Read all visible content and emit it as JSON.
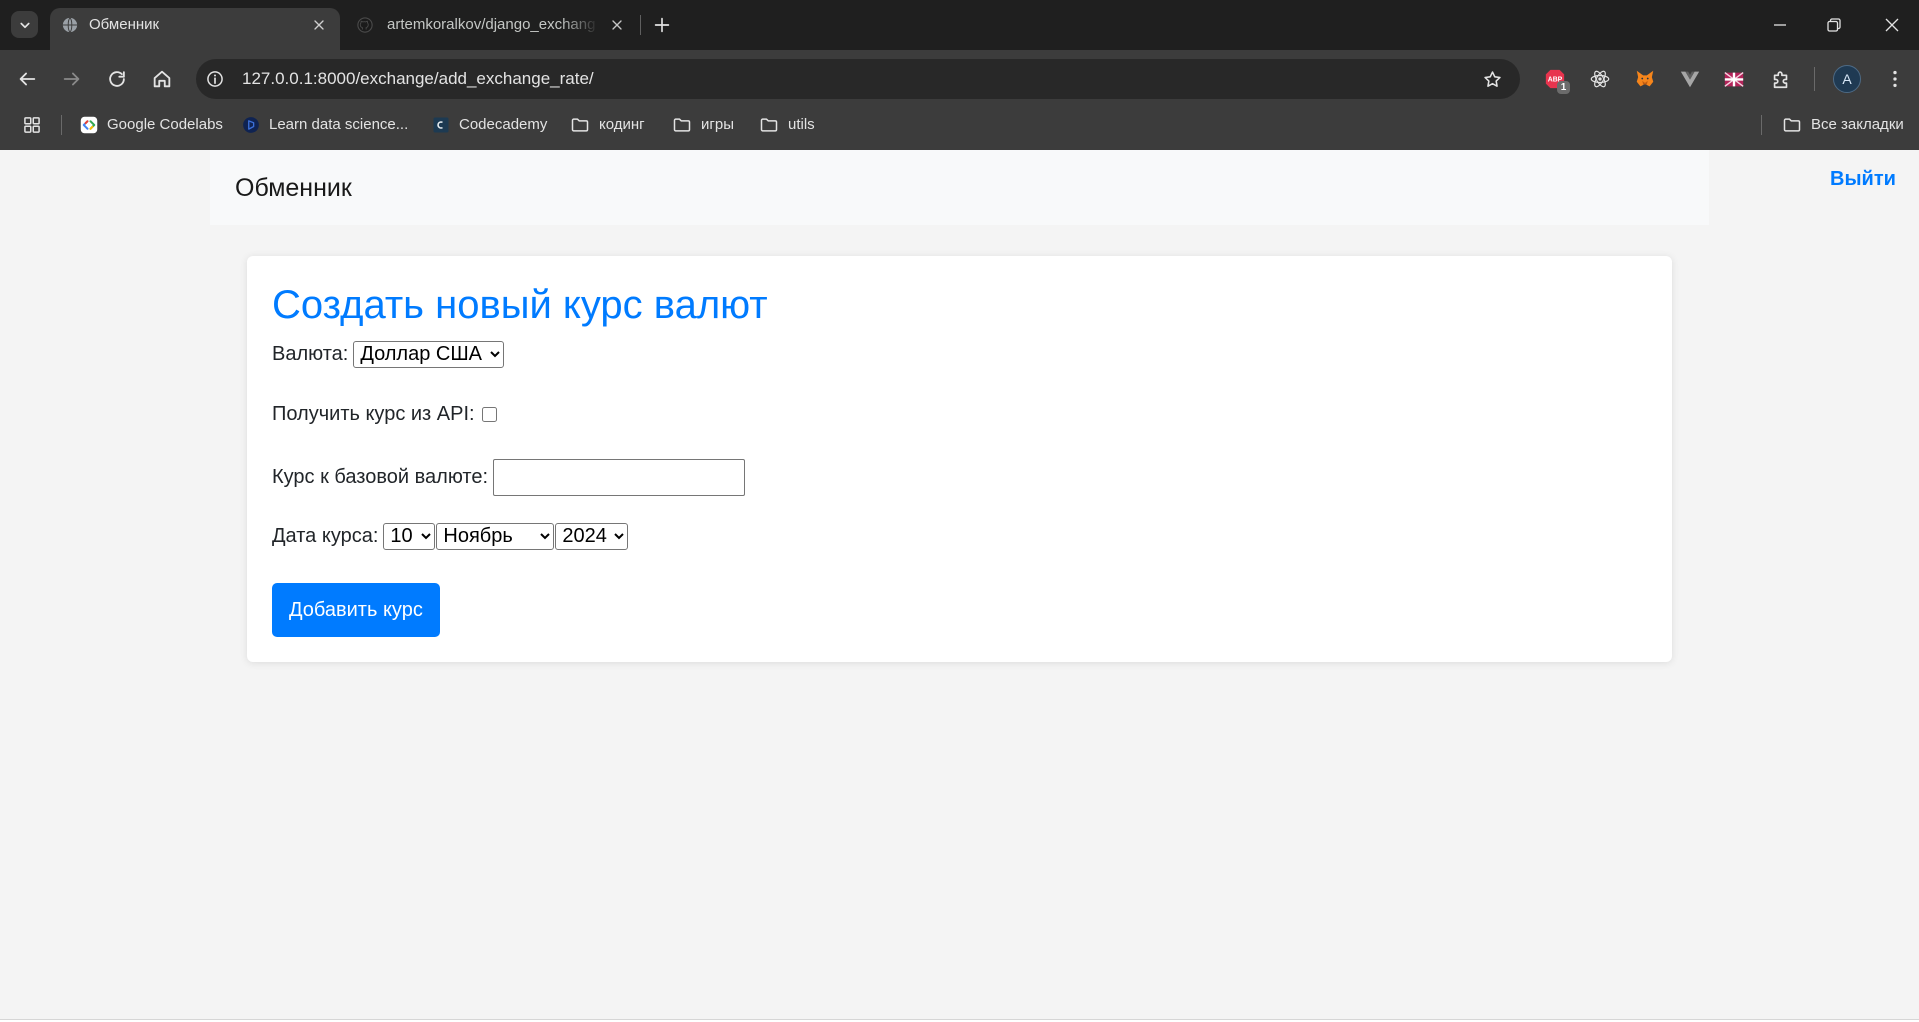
{
  "browser": {
    "tabs": [
      {
        "title": "Обменник",
        "icon": "globe-icon",
        "active": true
      },
      {
        "title": "artemkoralkov/django_exchang",
        "icon": "github-icon",
        "active": false
      }
    ],
    "url": "127.0.0.1:8000/exchange/add_exchange_rate/",
    "extensions": [
      {
        "icon": "adblock-plus-icon",
        "logo_text": "ABP",
        "badge": "1"
      },
      {
        "icon": "react-devtools-icon"
      },
      {
        "icon": "metamask-icon"
      },
      {
        "icon": "vue-devtools-icon"
      },
      {
        "icon": "extension-flag-icon"
      },
      {
        "icon": "extensions-puzzle-icon"
      }
    ],
    "profile": {
      "initial": "A"
    },
    "bookmarks": [
      {
        "label": "Google Codelabs",
        "icon": "codelabs-icon"
      },
      {
        "label": "Learn data science...",
        "icon": "learn-data-science-icon"
      },
      {
        "label": "Codecademy",
        "icon": "codecademy-icon"
      },
      {
        "label": "кодинг",
        "icon": "folder-icon"
      },
      {
        "label": "игры",
        "icon": "folder-icon"
      },
      {
        "label": "utils",
        "icon": "folder-icon"
      }
    ],
    "all_bookmarks": {
      "label": "Все закладки",
      "icon": "folder-icon"
    }
  },
  "page": {
    "brand": "Обменник",
    "logout": "Выйти",
    "form": {
      "title": "Создать новый курс валют",
      "currency": {
        "label": "Валюта:",
        "selected": "Доллар США"
      },
      "from_api": {
        "label": "Получить курс из API:",
        "checked": false
      },
      "rate": {
        "label": "Курс к базовой валюте:",
        "value": ""
      },
      "date": {
        "label": "Дата курса:",
        "day": "10",
        "month": "Ноябрь",
        "year": "2024"
      },
      "submit": "Добавить курс"
    }
  },
  "colors": {
    "accent": "#007bff",
    "page_background": "#f4f4f4",
    "browser_toolbar": "#3c3c3c",
    "browser_tabstrip": "#1f1f1f"
  }
}
